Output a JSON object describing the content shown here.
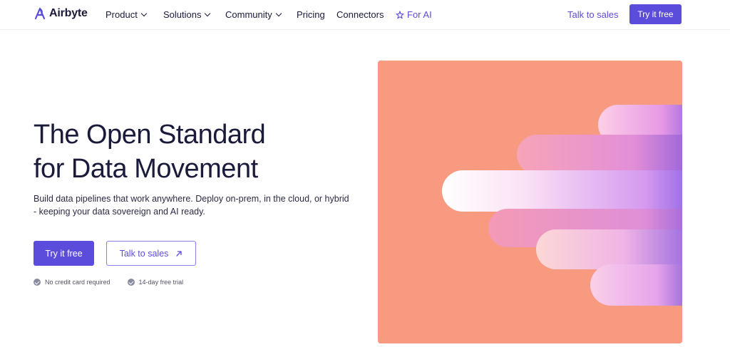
{
  "nav": {
    "brand": "Airbyte",
    "items": [
      {
        "label": "Product",
        "has_dropdown": true
      },
      {
        "label": "Solutions",
        "has_dropdown": true
      },
      {
        "label": "Community",
        "has_dropdown": true
      },
      {
        "label": "Pricing",
        "has_dropdown": false
      },
      {
        "label": "Connectors",
        "has_dropdown": false
      }
    ],
    "for_ai": "For AI",
    "talk_to_sales": "Talk to sales",
    "try_it_free": "Try it free"
  },
  "hero": {
    "headline_line1": "The Open Standard",
    "headline_line2": "for Data Movement",
    "sub_line1": "Build data pipelines that work anywhere. Deploy on-prem, in the cloud, or hybrid",
    "sub_line2": "- keeping your data sovereign and AI ready.",
    "cta_primary": "Try it free",
    "cta_secondary": "Talk to sales",
    "note_1": "No credit card required",
    "note_2": "14-day free trial"
  },
  "colors": {
    "accent": "#5b4cdb",
    "art_background": "#f79a80",
    "text": "#1a1a3a"
  },
  "icons": {
    "logo": "airbyte-logo-icon",
    "for_ai": "sparkle-star-icon",
    "external": "arrow-up-right-icon",
    "check": "check-circle-icon"
  }
}
